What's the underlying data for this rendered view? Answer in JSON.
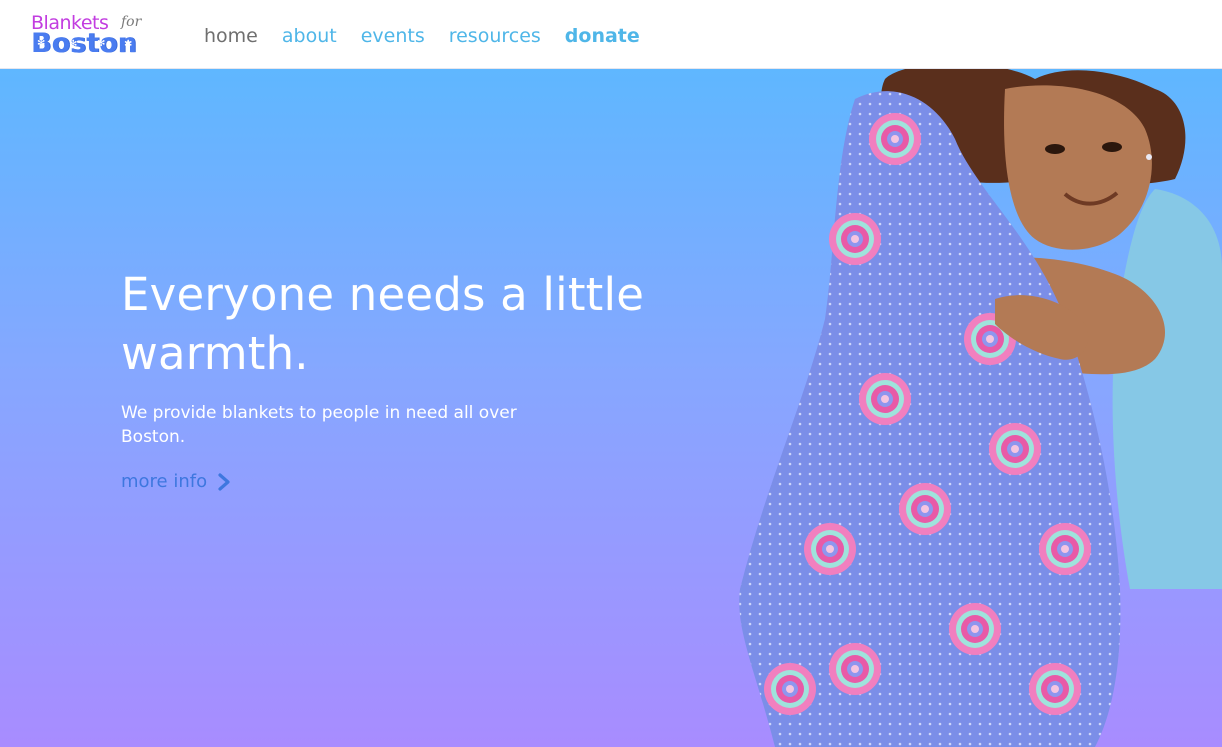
{
  "logo": {
    "line1": "Blankets",
    "for": "for",
    "line2": "Boston"
  },
  "nav": {
    "items": [
      {
        "label": "home"
      },
      {
        "label": "about"
      },
      {
        "label": "events"
      },
      {
        "label": "resources"
      },
      {
        "label": "donate"
      }
    ]
  },
  "hero": {
    "headline": "Everyone needs a little warmth.",
    "subtext": "We provide blankets to people in need all over Boston.",
    "more_link": "more info",
    "more_icon": "chevron-right-icon",
    "photo_icon": "child-hugging-blanket-photo"
  },
  "colors": {
    "nav_link": "#4fb6e8",
    "nav_active": "#6f6f6f",
    "logo_purple": "#c23de0",
    "logo_blue": "#4a7cf0",
    "gradient_top": "#5fb7ff",
    "gradient_bottom": "#a88cff",
    "more_link": "#3e77df"
  }
}
